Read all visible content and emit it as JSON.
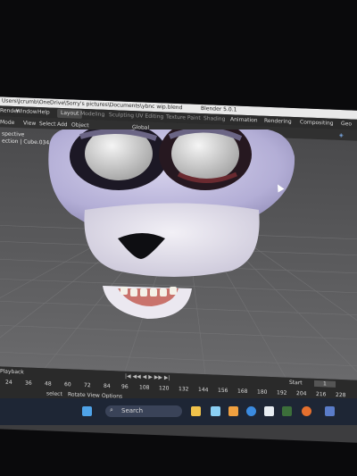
{
  "window": {
    "path_title": "Users\\Jcrumb\\OneDrive\\Sorry's pictures\\Documents\\ybnc wip.blend",
    "app_title": "Blender 5.0.1"
  },
  "menubar": {
    "items": [
      "Render",
      "Window",
      "Help",
      "Layout",
      "Modeling",
      "Sculpting",
      "UV Editing",
      "Texture Paint",
      "Shading",
      "Animation",
      "Rendering",
      "Compositing",
      "Geo"
    ]
  },
  "header3d": {
    "mode": "Mode",
    "view": "View",
    "select": "Select",
    "add": "Add",
    "object": "Object",
    "orientation": "Global"
  },
  "viewport": {
    "overlay_line1": "spective",
    "overlay_line2": "ection | Cube.034"
  },
  "timeline": {
    "menu": "Playback",
    "frames": [
      "24",
      "36",
      "48",
      "60",
      "72",
      "84",
      "96",
      "108",
      "120",
      "132",
      "144",
      "156",
      "168",
      "180",
      "192",
      "204",
      "216",
      "228"
    ],
    "status_left": "select",
    "status_rotate": "Rotate View",
    "status_options": "Options",
    "start_label": "Start",
    "start_value": "1"
  },
  "taskbar": {
    "search_placeholder": "Search"
  }
}
